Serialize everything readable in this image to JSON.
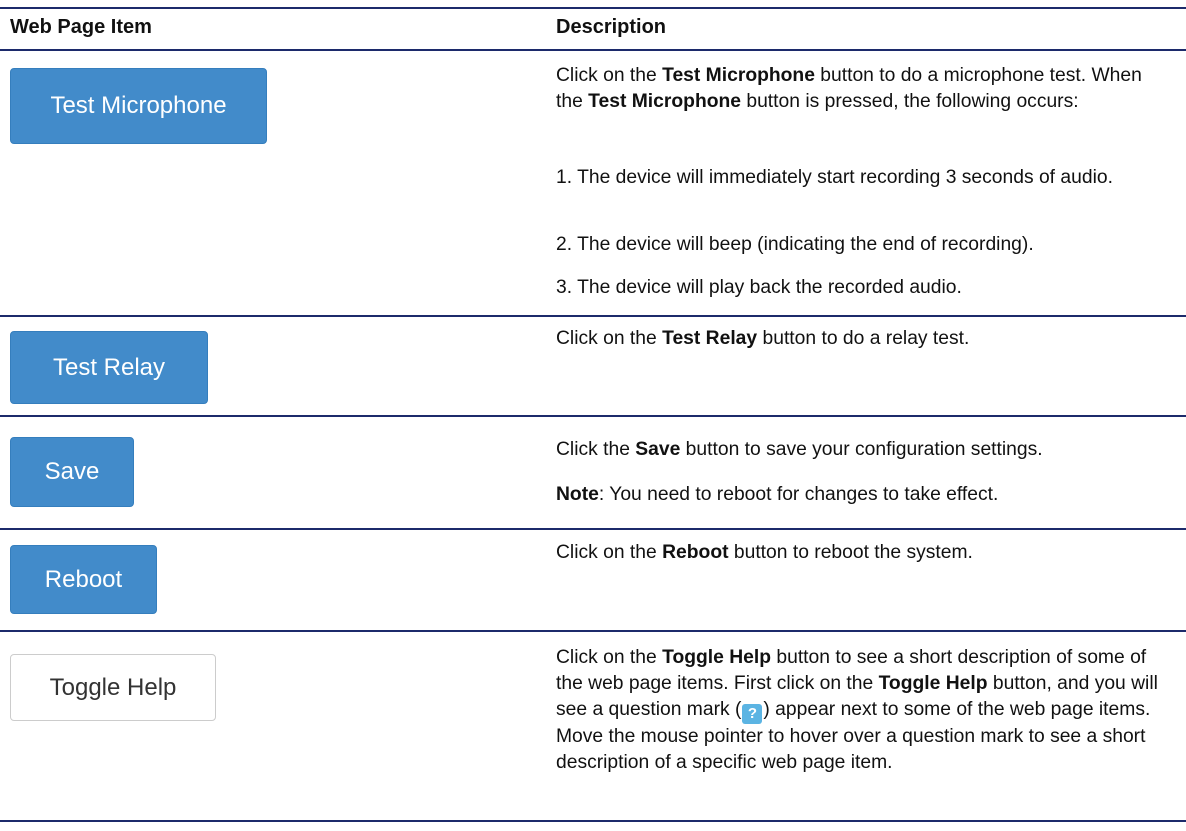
{
  "header": {
    "col1": "Web Page Item",
    "col2": "Description"
  },
  "rows": [
    {
      "button": "Test Microphone",
      "desc": [
        "Click on the ",
        "Test Microphone",
        " button to do a microphone test. When the ",
        "Test Microphone",
        " button is pressed, the following occurs:"
      ],
      "steps": [
        "1. The device will immediately start recording 3 seconds of audio.",
        "2. The device will beep (indicating the end of recording).",
        "3. The device will play back the recorded audio."
      ]
    },
    {
      "button": "Test Relay",
      "desc": [
        "Click on the ",
        "Test Relay",
        " button to do a relay test."
      ]
    },
    {
      "button": "Save",
      "desc": [
        "Click the ",
        "Save",
        " button to save your configuration settings."
      ],
      "note_label": "Note",
      "note_text": ": You need to reboot for changes to take effect."
    },
    {
      "button": "Reboot",
      "desc": [
        "Click on the ",
        "Reboot",
        " button to reboot the system."
      ]
    },
    {
      "button": "Toggle Help",
      "desc": [
        "Click on the ",
        "Toggle Help",
        " button to see a short description of some of the web page items. First click on the ",
        "Toggle Help",
        " button, and you will see a question mark (",
        "?",
        ") appear next to some of the web page items. Move the mouse pointer to hover over a question mark to see a short description of a specific web page item."
      ]
    }
  ],
  "colors": {
    "rule": "#1c2a6b",
    "primary_button": "#428bca",
    "help_icon": "#5bb4e3"
  }
}
